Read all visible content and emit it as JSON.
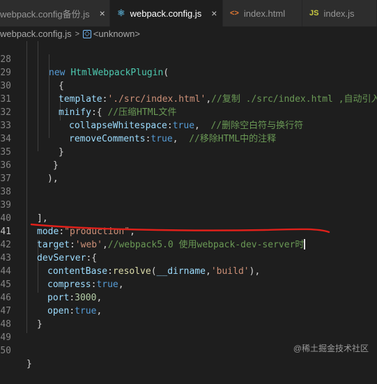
{
  "tabs": [
    {
      "label": "webpack.config备份.js",
      "icon": "js-file-icon",
      "active": false
    },
    {
      "label": "webpack.config.js",
      "icon": "webpack-file-icon",
      "active": true
    },
    {
      "label": "index.html",
      "icon": "html-file-icon",
      "active": false
    },
    {
      "label": "index.js",
      "icon": "js-file-icon",
      "active": false
    }
  ],
  "tab_glyphs": {
    "react": "⚛",
    "html": "<>",
    "js": "JS",
    "close": "×"
  },
  "breadcrumb": {
    "file": "webpack.config.js",
    "separator": ">",
    "symbol_glyph": "◇",
    "symbol": "<unknown>"
  },
  "line_numbers": [
    "28",
    "29",
    "30",
    "31",
    "32",
    "33",
    "34",
    "35",
    "36",
    "37",
    "38",
    "39",
    "40",
    "41",
    "42",
    "43",
    "44",
    "45",
    "46",
    "47",
    "48",
    "49",
    "50"
  ],
  "code": {
    "l28": {
      "kw": "new ",
      "cls": "HtmlWebpackPlugin",
      "p": "("
    },
    "l29": {
      "p": "{"
    },
    "l30": {
      "prop": "template",
      "colon": ":",
      "str": "'./src/index.html'",
      "comma": ",",
      "cmt": "//复制 ./src/index.html ,自动引入"
    },
    "l31": {
      "prop": "minify",
      "p": ":{ ",
      "cmt": "//压缩HTML文件"
    },
    "l32": {
      "prop": "collapseWhitespace",
      "colon": ":",
      "kw": "true",
      "comma": ",  ",
      "cmt": "//删除空白符与换行符"
    },
    "l33": {
      "prop": "removeComments",
      "colon": ":",
      "kw": "true",
      "comma": ",  ",
      "cmt": "//移除HTML中的注释"
    },
    "l34": {
      "p": "}"
    },
    "l35": {
      "p": "}"
    },
    "l36": {
      "p": "),"
    },
    "l39": {
      "p": "],"
    },
    "l40": {
      "prop": "mode",
      "colon": ":",
      "str": "\"production\"",
      "comma": ","
    },
    "l41": {
      "prop": "target",
      "colon": ":",
      "str": "'web'",
      "comma": ",",
      "cmt": "//webpack5.0 使用webpack-dev-server时"
    },
    "l42": {
      "prop": "devServer",
      "p": ":{"
    },
    "l43": {
      "prop": "contentBase",
      "colon": ":",
      "fn": "resolve",
      "open": "(",
      "var": "__dirname",
      "comma": ",",
      "str": "'build'",
      "close": "),"
    },
    "l44": {
      "prop": "compress",
      "colon": ":",
      "kw": "true",
      "comma": ","
    },
    "l45": {
      "prop": "port",
      "colon": ":",
      "num": "3000",
      "comma": ","
    },
    "l46": {
      "prop": "open",
      "colon": ":",
      "kw": "true",
      "comma": ","
    },
    "l47": {
      "p": "}"
    },
    "l50": {
      "p": "}"
    }
  },
  "annotation_color": "#e0201a",
  "watermark": "@稀土掘金技术社区"
}
